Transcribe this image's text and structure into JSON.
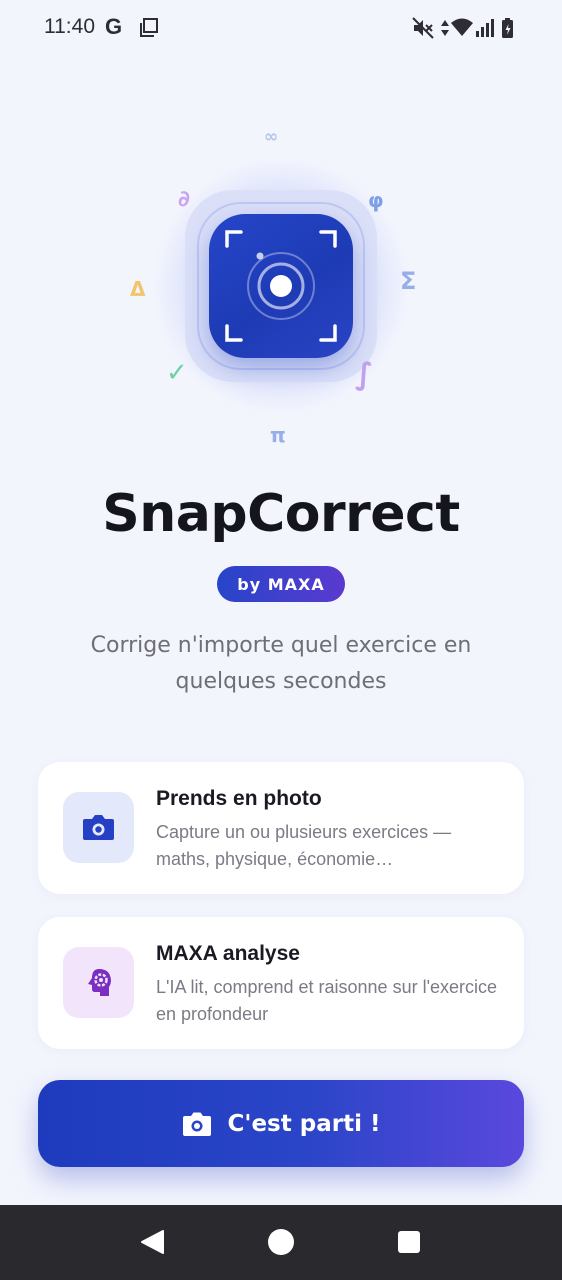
{
  "status_bar": {
    "time": "11:40",
    "google_mark": "G",
    "icons": [
      "screenshot-icon",
      "mute-icon",
      "data-icon",
      "wifi-icon",
      "signal-icon",
      "battery-icon"
    ]
  },
  "hero": {
    "icon": "camera-scan-icon",
    "symbols": {
      "infinity": "∞",
      "partial": "∂",
      "phi": "φ",
      "delta": "Δ",
      "sigma": "Σ",
      "check": "✓",
      "integral": "∫",
      "pi": "π"
    }
  },
  "app": {
    "title": "SnapCorrect",
    "badge": "by MAXA",
    "tagline": "Corrige n'importe quel exercice en quelques secondes"
  },
  "features": [
    {
      "icon": "camera-icon",
      "title": "Prends en photo",
      "description": "Capture un ou plusieurs exercices — maths, physique, économie…"
    },
    {
      "icon": "brain-gear-icon",
      "title": "MAXA analyse",
      "description": "L'IA lit, comprend et raisonne sur l'exercice en profondeur"
    }
  ],
  "cta": {
    "icon": "camera-icon",
    "label": "C'est parti !"
  },
  "nav": {
    "icons": [
      "back-icon",
      "home-icon",
      "recents-icon"
    ]
  },
  "colors": {
    "background": "#f3f5fd",
    "primary": "#1f3bbd",
    "accent_purple": "#5a3ad0",
    "card": "#ffffff"
  }
}
